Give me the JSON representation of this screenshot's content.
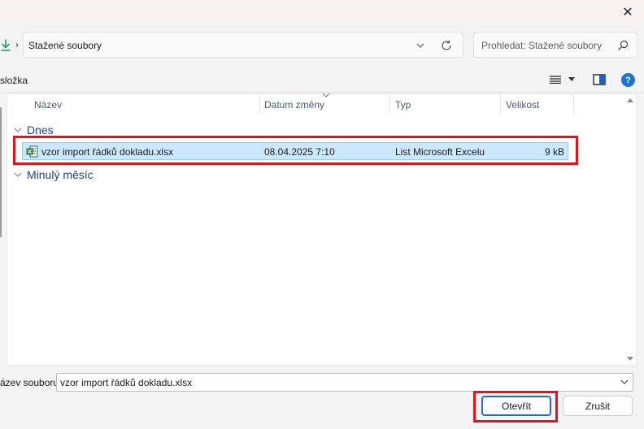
{
  "titlebar": {
    "close_glyph": "✕"
  },
  "nav": {
    "location_icon": "download-arrow-icon",
    "breadcrumb_separator": "›",
    "address": "Stažené soubory",
    "search_placeholder": "Prohledat: Stažené soubory"
  },
  "toolbar": {
    "new_folder_label": "složka",
    "help_glyph": "?"
  },
  "columns": {
    "name": "Název",
    "date": "Datum změny",
    "type": "Typ",
    "size": "Velikost"
  },
  "groups": {
    "today": "Dnes",
    "last_month": "Minulý měsíc"
  },
  "files": [
    {
      "name": "vzor import řádků dokladu.xlsx",
      "date": "08.04.2025 7:10",
      "type": "List Microsoft Excelu",
      "size": "9 kB",
      "icon": "excel-file-icon"
    }
  ],
  "bottom": {
    "filename_label": "ázev souboru:",
    "filename_value": "vzor import řádků dokladu.xlsx",
    "open_label": "Otevřít",
    "cancel_label": "Zrušit"
  },
  "colors": {
    "accent": "#2867c4",
    "selection": "#cce8ff",
    "annotation_red": "#e0141e",
    "excel_green": "#1d7a44"
  }
}
